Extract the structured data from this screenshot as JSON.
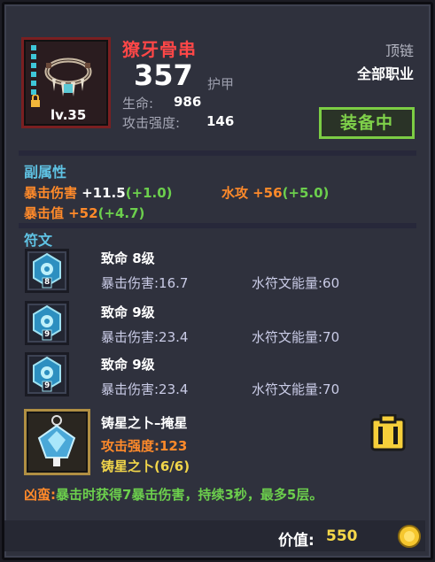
{
  "item": {
    "name": "獠牙骨串",
    "armor_value": "357",
    "armor_label": "护甲",
    "level": "lv.35",
    "stats": [
      {
        "label": "生命:",
        "value": "986"
      },
      {
        "label": "攻击强度:",
        "value": "146"
      }
    ],
    "slot_type": "顶链",
    "job": "全部职业",
    "equip_button": "装备中"
  },
  "secondary": {
    "title": "副属性",
    "attrs": [
      {
        "name": "暴击伤害",
        "value": "+11.5",
        "bonus": "(+1.0)"
      },
      {
        "name": "水攻",
        "value": "+56",
        "bonus": "(+5.0)"
      },
      {
        "name": "暴击值",
        "value": "+52",
        "bonus": "(+4.7)"
      }
    ]
  },
  "runes": {
    "title": "符文",
    "items": [
      {
        "name": "致命 8级",
        "stat": "暴击伤害:16.7",
        "energy": "水符文能量:60",
        "badge": "8"
      },
      {
        "name": "致命 9级",
        "stat": "暴击伤害:23.4",
        "energy": "水符文能量:70",
        "badge": "9"
      },
      {
        "name": "致命 9级",
        "stat": "暴击伤害:23.4",
        "energy": "水符文能量:70",
        "badge": "9"
      }
    ],
    "set": {
      "name": "铸星之卜–掩星",
      "stat": "攻击强度:123",
      "set_bonus": "铸星之卜(6/6)"
    }
  },
  "effect": {
    "label": "凶蛮:",
    "text": "暴击时获得7暴击伤害，持续3秒，最多5层。"
  },
  "footer": {
    "price_label": "价值:",
    "price_value": "550"
  },
  "colors": {
    "item_name": "#ff4747",
    "section_title": "#5fc3e4",
    "equip_green": "#7fd14a",
    "attr_orange": "#ff8a2a",
    "bonus_green": "#6ccf4d",
    "gold": "#f6d84a"
  },
  "icons": {
    "item": "fang-necklace-icon",
    "lock": "lock-icon",
    "rune": "water-rune-icon",
    "set_rune": "star-crystal-icon",
    "lock_toggle": "padlock-toggle-icon",
    "coin": "gold-coin-icon"
  }
}
